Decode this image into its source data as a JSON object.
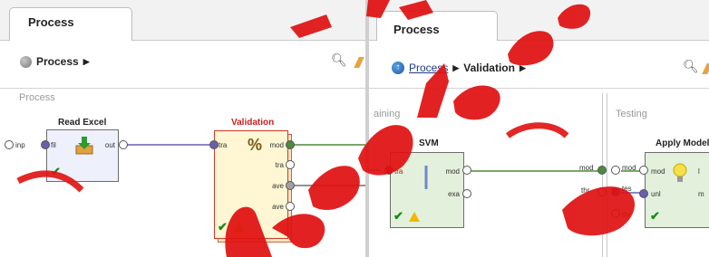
{
  "left_panel": {
    "tab_label": "Process",
    "breadcrumb": {
      "label": "Process",
      "arrow": "▶",
      "icon": "process-dot-icon"
    },
    "canvas_label": "Process",
    "input_port": "inp",
    "read_excel": {
      "title": "Read Excel",
      "in_port": "fil",
      "out_port": "out"
    },
    "validation": {
      "title": "Validation",
      "in_port": "tra",
      "out_ports": [
        "mod",
        "tra",
        "ave",
        "ave"
      ]
    }
  },
  "right_panel": {
    "tab_label": "Process",
    "breadcrumb": {
      "root": "Process",
      "child": "Validation",
      "arrow": "▶",
      "icon": "up-arrow-icon"
    },
    "training_label": "aining",
    "testing_label": "Testing",
    "svm": {
      "title": "SVM",
      "in_port": "tra",
      "out_ports": [
        "mod",
        "exa"
      ]
    },
    "apply_model": {
      "title": "Apply Model",
      "in_ports": [
        "mod",
        "unl"
      ],
      "out_ports": [
        "l",
        "m"
      ]
    },
    "testing_inputs": [
      "mod",
      "tes",
      "thr"
    ],
    "training_outputs": [
      "mod",
      "thr"
    ]
  },
  "colors": {
    "validation_title": "#cc1f1f",
    "validation_fill": "#fff6d3",
    "op_fill": "#eef0fb",
    "svm_fill": "#e2f0dc",
    "apply_fill": "#e2f0dc",
    "watermark": "#e01010"
  }
}
